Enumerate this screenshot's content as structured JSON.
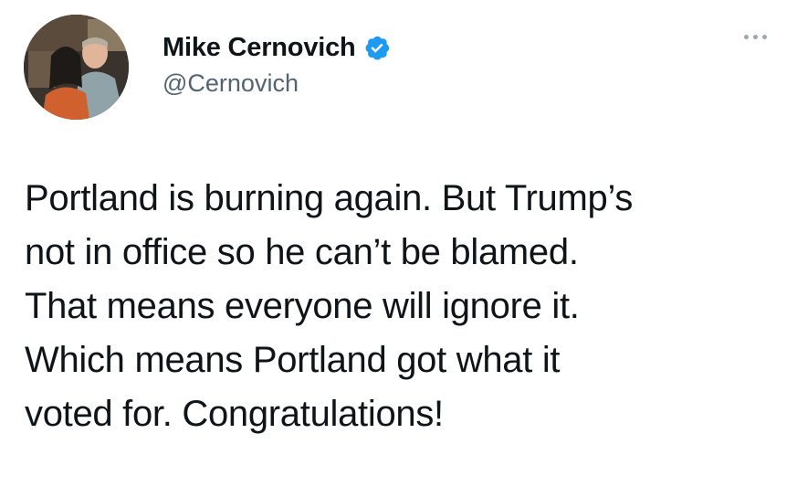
{
  "author": {
    "display_name": "Mike Cernovich",
    "handle": "@Cernovich",
    "verified": true,
    "avatar_icon": "profile-photo"
  },
  "more_menu_icon": "ellipsis-icon",
  "tweet": {
    "lines": [
      "Portland is burning again. But Trump’s",
      "not in office so he can’t be blamed.",
      "That means everyone will ignore it.",
      "Which means Portland got what it",
      "voted for. Congratulations!"
    ]
  },
  "colors": {
    "verified_badge": "#1d9bf0",
    "handle": "#536471",
    "text": "#0f1419"
  }
}
